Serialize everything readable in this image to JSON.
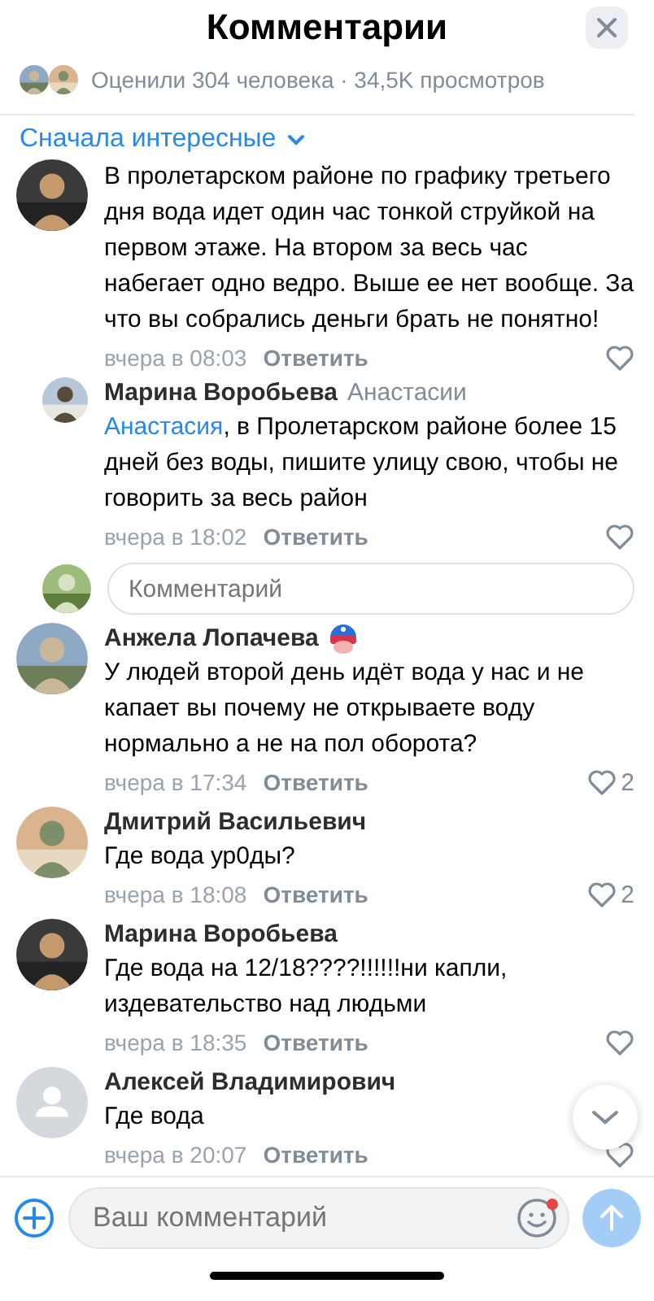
{
  "header": {
    "title": "Комментарии",
    "stats": "Оценили 304 человека · 34,5K просмотров",
    "sort": "Сначала интересные"
  },
  "comments": [
    {
      "kind": "comment",
      "has_photo": true,
      "text": "В пролетарском районе по графику третьего дня вода идет один час тонкой струйкой на первом этаже. На втором за весь час набегает одно ведро. Выше ее нет вообще. За что вы собрались деньги брать не понятно!",
      "time": "вчера в 08:03",
      "reply_label": "Ответить",
      "replies": [
        {
          "kind": "comment",
          "has_photo": true,
          "author": "Марина Воробьева",
          "reply_to": "Анастасии",
          "mention": "Анастасия",
          "text": ", в Пролетарском районе более 15 дней без воды, пишите улицу свою, чтобы не говорить за весь район",
          "time": "вчера в 18:02",
          "reply_label": "Ответить"
        },
        {
          "kind": "reply_box",
          "placeholder": "Комментарий"
        }
      ]
    },
    {
      "kind": "comment",
      "has_photo": true,
      "author": "Анжела Лопачева",
      "badge": true,
      "text": "У людей второй день идёт вода у нас и не капает вы почему не открываете воду нормально а не на пол оборота?",
      "time": "вчера в 17:34",
      "reply_label": "Ответить",
      "likes": "2"
    },
    {
      "kind": "comment",
      "has_photo": true,
      "author": "Дмитрий Васильевич",
      "text": "Где вода ур0ды?",
      "time": "вчера в 18:08",
      "reply_label": "Ответить",
      "likes": "2"
    },
    {
      "kind": "comment",
      "has_photo": true,
      "author": "Марина Воробьева",
      "text": "Где вода на 12/18????!!!!!!ни капли, издевательство над людьми",
      "time": "вчера в 18:35",
      "reply_label": "Ответить"
    },
    {
      "kind": "comment",
      "has_photo": false,
      "author": "Алексей Владимирович",
      "text": "Где вода",
      "time": "вчера в 20:07",
      "reply_label": "Ответить"
    }
  ],
  "composer": {
    "placeholder": "Ваш комментарий",
    "emoji_notification": true
  }
}
